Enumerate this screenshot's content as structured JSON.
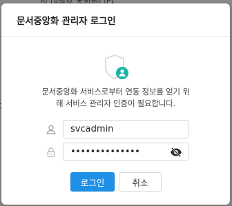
{
  "background": {
    "top_text": "이 내역을 조회합니다",
    "left_text": "이"
  },
  "dialog": {
    "title": "문서중앙화 관리자 로그인",
    "message_line1": "문서중앙화 서비스로부터 연동 정보를 얻기 위",
    "message_line2": "해 서비스 관리자 인증이 필요합니다.",
    "shield_icon": "shield-user-icon",
    "accent_color": "#1bb3a5"
  },
  "form": {
    "username_value": "svcadmin",
    "password_masked": "••••••••••••••",
    "user_icon": "user-icon",
    "lock_icon": "lock-icon",
    "toggle_icon": "eye-slash-icon"
  },
  "buttons": {
    "login_label": "로그인",
    "cancel_label": "취소",
    "login_color": "#1e90e8"
  }
}
